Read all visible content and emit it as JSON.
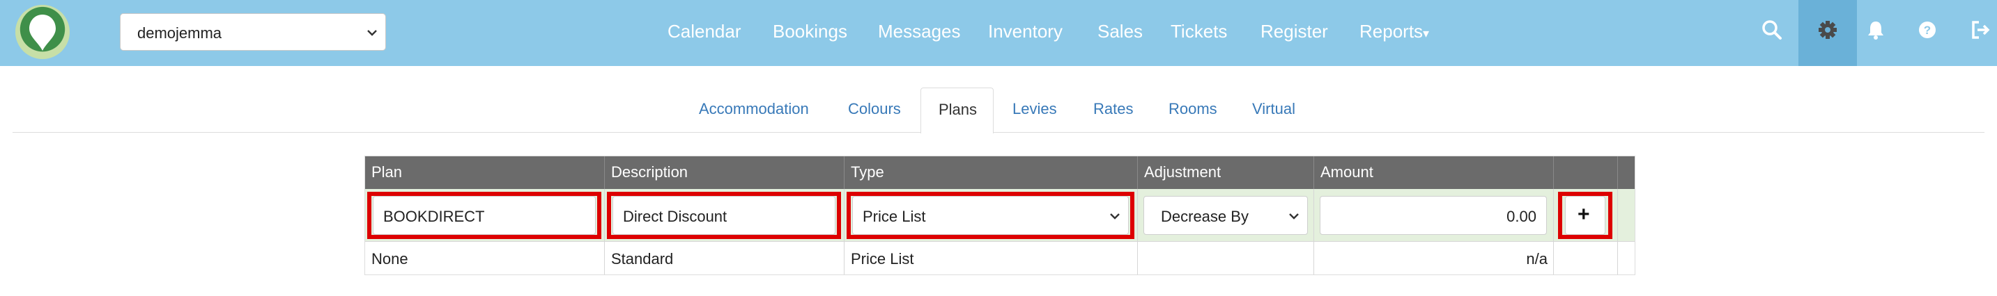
{
  "account": {
    "selected": "demojemma"
  },
  "nav": {
    "items": [
      "Calendar",
      "Bookings",
      "Messages",
      "Inventory",
      "Sales",
      "Tickets",
      "Register",
      "Reports"
    ],
    "reports_caret": "▾"
  },
  "icons": {
    "search": "search-icon",
    "settings": "gear-icon",
    "notifications": "bell-icon",
    "help": "question-icon",
    "logout": "sign-out-icon"
  },
  "tabs": {
    "items": [
      "Accommodation",
      "Colours",
      "Plans",
      "Levies",
      "Rates",
      "Rooms",
      "Virtual"
    ],
    "active": "Plans"
  },
  "table": {
    "headers": [
      "Plan",
      "Description",
      "Type",
      "Adjustment",
      "Amount",
      ""
    ],
    "new_row": {
      "plan": "BOOKDIRECT",
      "description": "Direct Discount",
      "type": "Price List",
      "adjustment": "Decrease By",
      "amount": "0.00",
      "add_label": "+"
    },
    "rows": [
      {
        "plan": "None",
        "description": "Standard",
        "type": "Price List",
        "adjustment": "",
        "amount": "n/a"
      }
    ]
  },
  "colors": {
    "topbar": "#8dc9e8",
    "highlight": "#dd0000",
    "header_bg": "#6b6b6b",
    "edit_row_bg": "#e4f0dd",
    "link": "#3879b8"
  }
}
